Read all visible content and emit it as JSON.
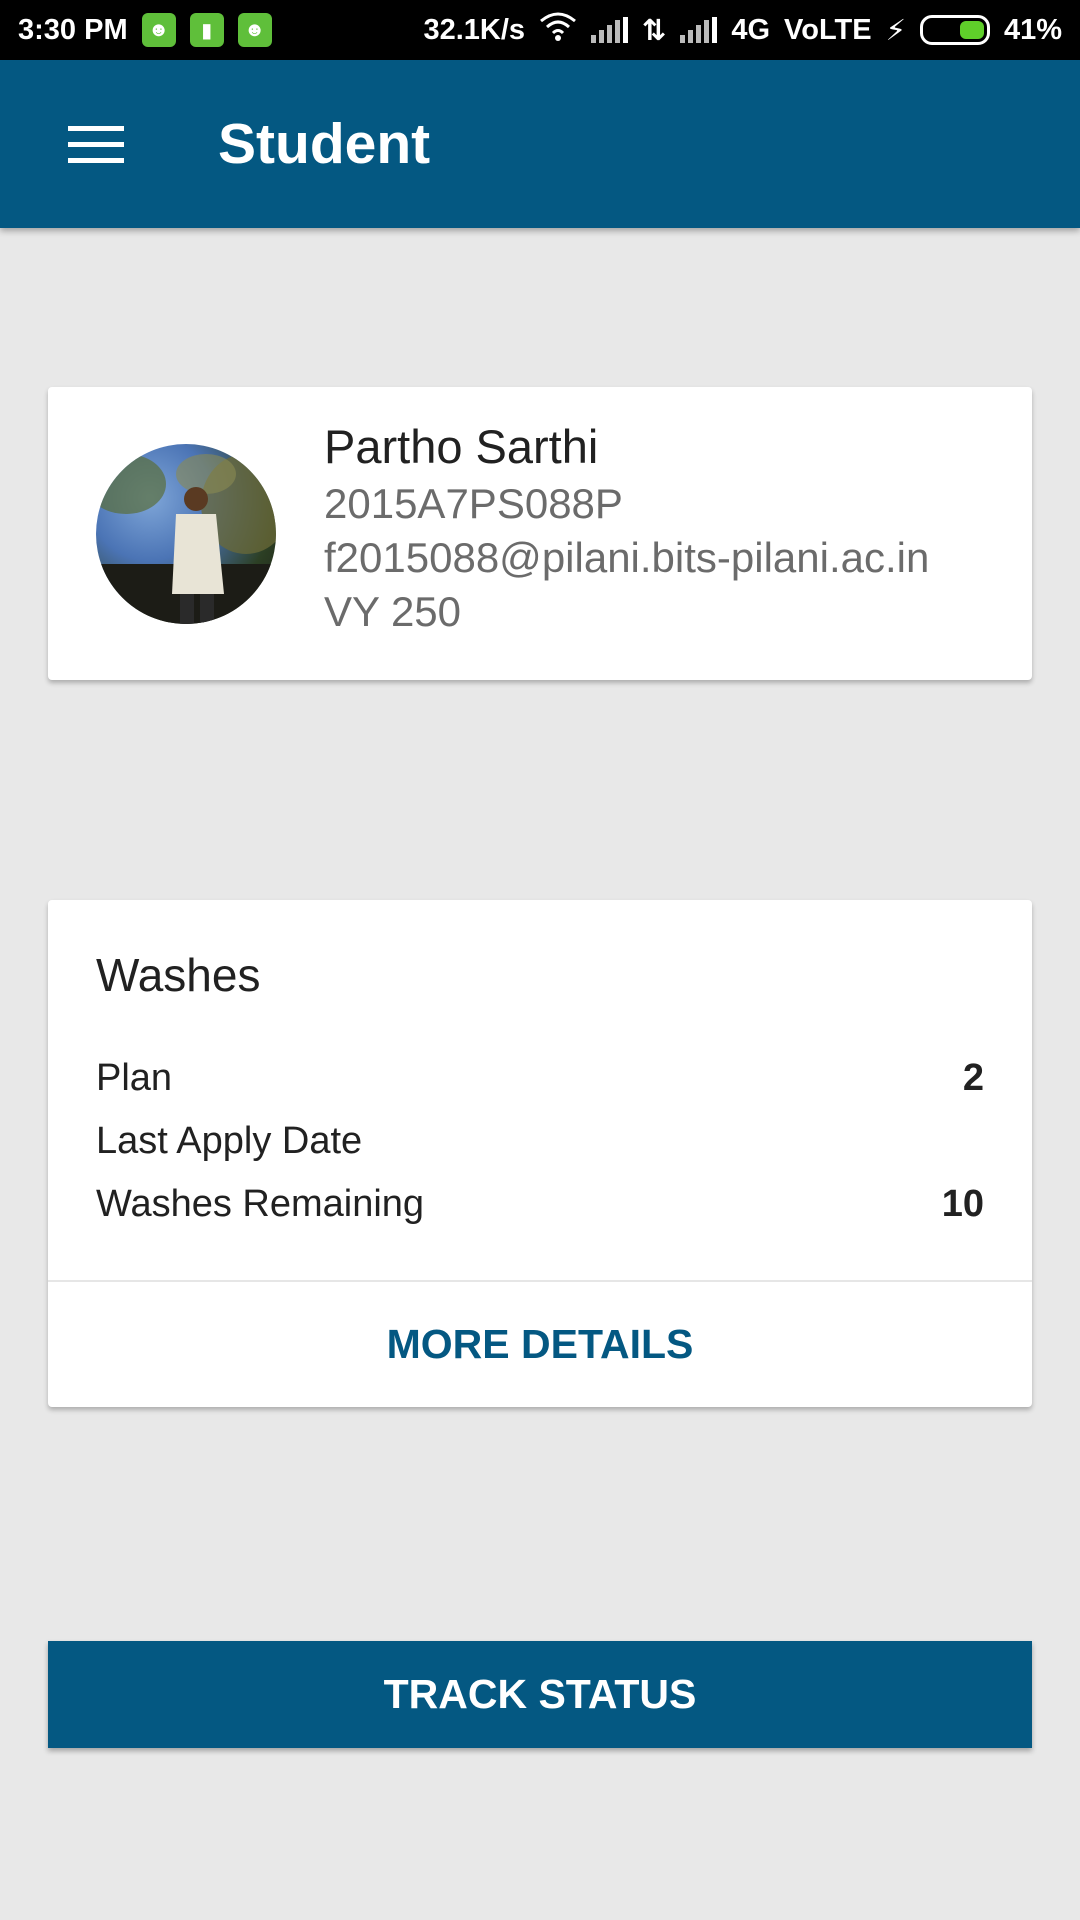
{
  "status_bar": {
    "time": "3:30 PM",
    "speed": "32.1K/s",
    "network": "4G",
    "volte": "VoLTE",
    "battery": "41%",
    "icons": [
      "android-notification-icon",
      "battery-notification-icon",
      "android-notification-icon",
      "wifi-icon",
      "signal-icon",
      "data-transfer-icon",
      "signal-icon",
      "charging-icon",
      "battery-icon"
    ]
  },
  "app_bar": {
    "title": "Student"
  },
  "profile": {
    "name": "Partho Sarthi",
    "id": "2015A7PS088P",
    "email": "f2015088@pilani.bits-pilani.ac.in",
    "room": "VY 250"
  },
  "washes": {
    "title": "Washes",
    "rows": [
      {
        "label": "Plan",
        "value": "2"
      },
      {
        "label": "Last Apply Date",
        "value": ""
      },
      {
        "label": "Washes Remaining",
        "value": "10"
      }
    ],
    "more_label": "MORE DETAILS"
  },
  "track_button": "TRACK STATUS",
  "colors": {
    "primary": "#045882",
    "background": "#e8e8e8"
  }
}
